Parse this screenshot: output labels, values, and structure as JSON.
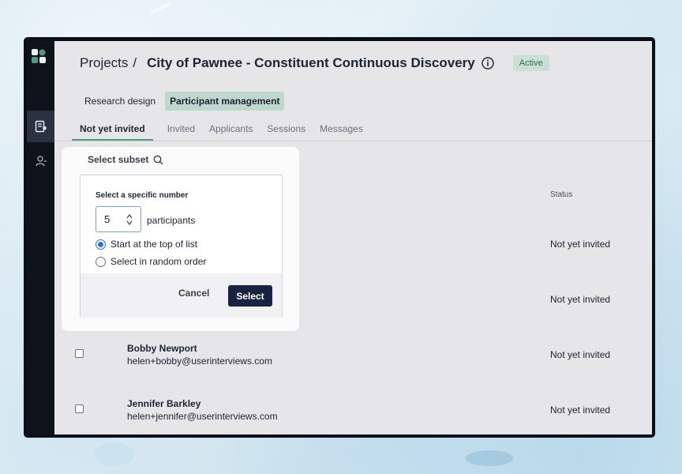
{
  "breadcrumb": {
    "root": "Projects",
    "separator": "/"
  },
  "page": {
    "title": "City of Pawnee - Constituent Continuous Discovery",
    "status_badge": "Active"
  },
  "sub_tabs": [
    {
      "label": "Research design",
      "active": false
    },
    {
      "label": "Participant management",
      "active": true
    }
  ],
  "tabs": [
    {
      "label": "Not yet invited",
      "active": true
    },
    {
      "label": "Invited",
      "active": false
    },
    {
      "label": "Applicants",
      "active": false
    },
    {
      "label": "Sessions",
      "active": false
    },
    {
      "label": "Messages",
      "active": false
    }
  ],
  "table": {
    "status_header": "Status",
    "rows": [
      {
        "name": "",
        "email": "",
        "status": "Not yet invited"
      },
      {
        "name": "",
        "email": "",
        "status": "Not yet invited"
      },
      {
        "name": "Bobby Newport",
        "email": "helen+bobby@userinterviews.com",
        "status": "Not yet invited"
      },
      {
        "name": "Jennifer Barkley",
        "email": "helen+jennifer@userinterviews.com",
        "status": "Not yet invited"
      }
    ]
  },
  "subset": {
    "label": "Select subset",
    "popup": {
      "title": "Select a specific number",
      "number_value": "5",
      "number_unit": "participants",
      "options": [
        {
          "label": "Start at the top of list",
          "selected": true
        },
        {
          "label": "Select in random order",
          "selected": false
        }
      ],
      "cancel_label": "Cancel",
      "select_label": "Select"
    }
  },
  "icons": {
    "logo": "app-logo-icon",
    "rail_projects": "document-icon",
    "rail_people": "person-icon",
    "search": "search-icon",
    "info": "info-icon"
  },
  "colors": {
    "active_badge_bg": "#c8e0d6",
    "active_tab_underline": "#4f9b83",
    "primary_button": "#172340",
    "radio_selected": "#2f6fe0"
  }
}
